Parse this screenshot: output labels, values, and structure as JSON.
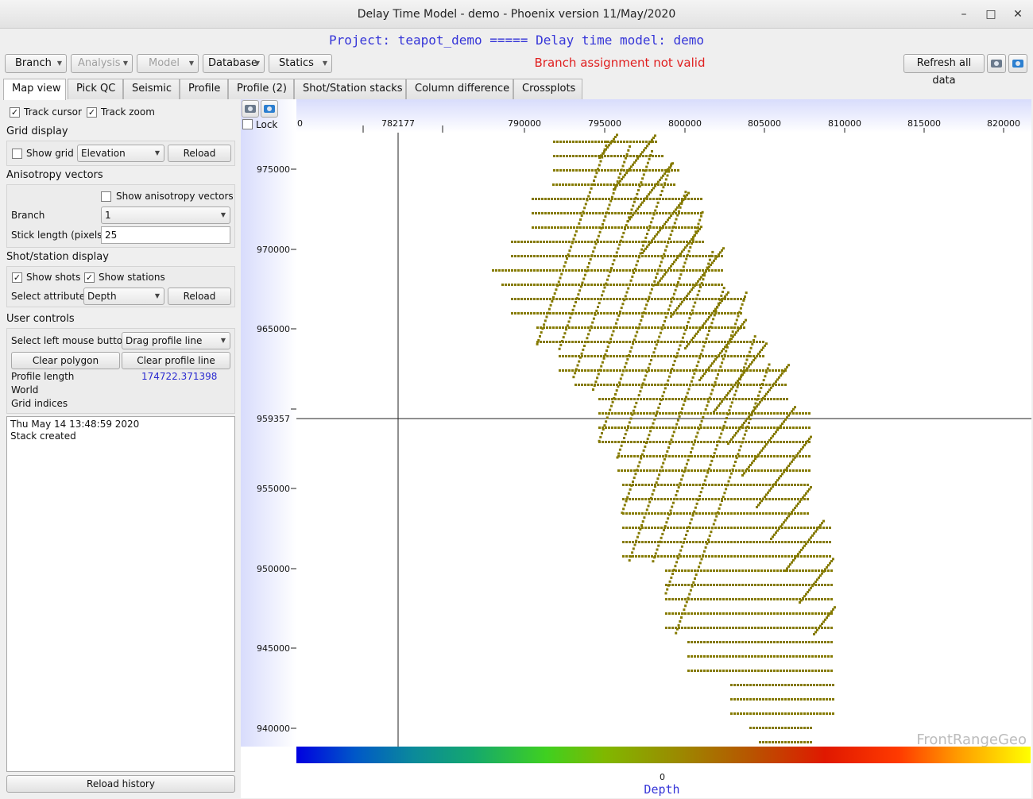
{
  "window": {
    "title": "Delay Time Model - demo - Phoenix version 11/May/2020",
    "minimize": "–",
    "maximize": "□",
    "close": "✕"
  },
  "project_line": "Project: teapot_demo ===== Delay time model: demo",
  "toolbar": {
    "branch": "Branch",
    "analysis": "Analysis",
    "model": "Model",
    "database": "Database",
    "statics": "Statics",
    "status": "Branch assignment not valid",
    "refresh": "Refresh all data",
    "icons": [
      "camera-gray-icon",
      "camera-blue-icon"
    ]
  },
  "tabs": [
    "Map view",
    "Pick QC",
    "Seismic",
    "Profile",
    "Profile (2)",
    "Shot/Station stacks",
    "Column difference",
    "Crossplots"
  ],
  "left": {
    "track_cursor": "Track cursor",
    "track_zoom": "Track zoom",
    "grid_display": "Grid display",
    "show_grid": "Show grid",
    "grid_attr": "Elevation",
    "reload": "Reload",
    "aniso_title": "Anisotropy vectors",
    "show_aniso": "Show anisotropy vectors",
    "branch_label": "Branch",
    "branch_value": "1",
    "stick_label": "Stick length (pixels)",
    "stick_value": "25",
    "shot_title": "Shot/station display",
    "show_shots": "Show shots",
    "show_stations": "Show stations",
    "select_attr": "Select attribute",
    "attr_value": "Depth",
    "reload2": "Reload",
    "user_controls": "User controls",
    "mouse_label": "Select left mouse button",
    "mouse_value": "Drag profile line",
    "clear_polygon": "Clear polygon",
    "clear_profile": "Clear profile line",
    "profile_length_label": "Profile length",
    "profile_length_value": "174722.371398",
    "world": "World",
    "grid_indices": "Grid indices",
    "history_line1": "Thu May 14 13:48:59 2020",
    "history_line2": "Stack created",
    "reload_history": "Reload history"
  },
  "map": {
    "lock": "Lock",
    "x_ticks": [
      "0",
      "790000",
      "795000",
      "800000",
      "805000",
      "810000",
      "815000",
      "820000"
    ],
    "x_cursor": "782177",
    "y_ticks": [
      "975000",
      "970000",
      "965000",
      "955000",
      "950000",
      "945000",
      "940000"
    ],
    "y_cursor": "959357",
    "watermark": "FrontRangeGeo",
    "colorbar_tick": "0",
    "colorbar_label": "Depth",
    "point_color": "#857a00"
  }
}
